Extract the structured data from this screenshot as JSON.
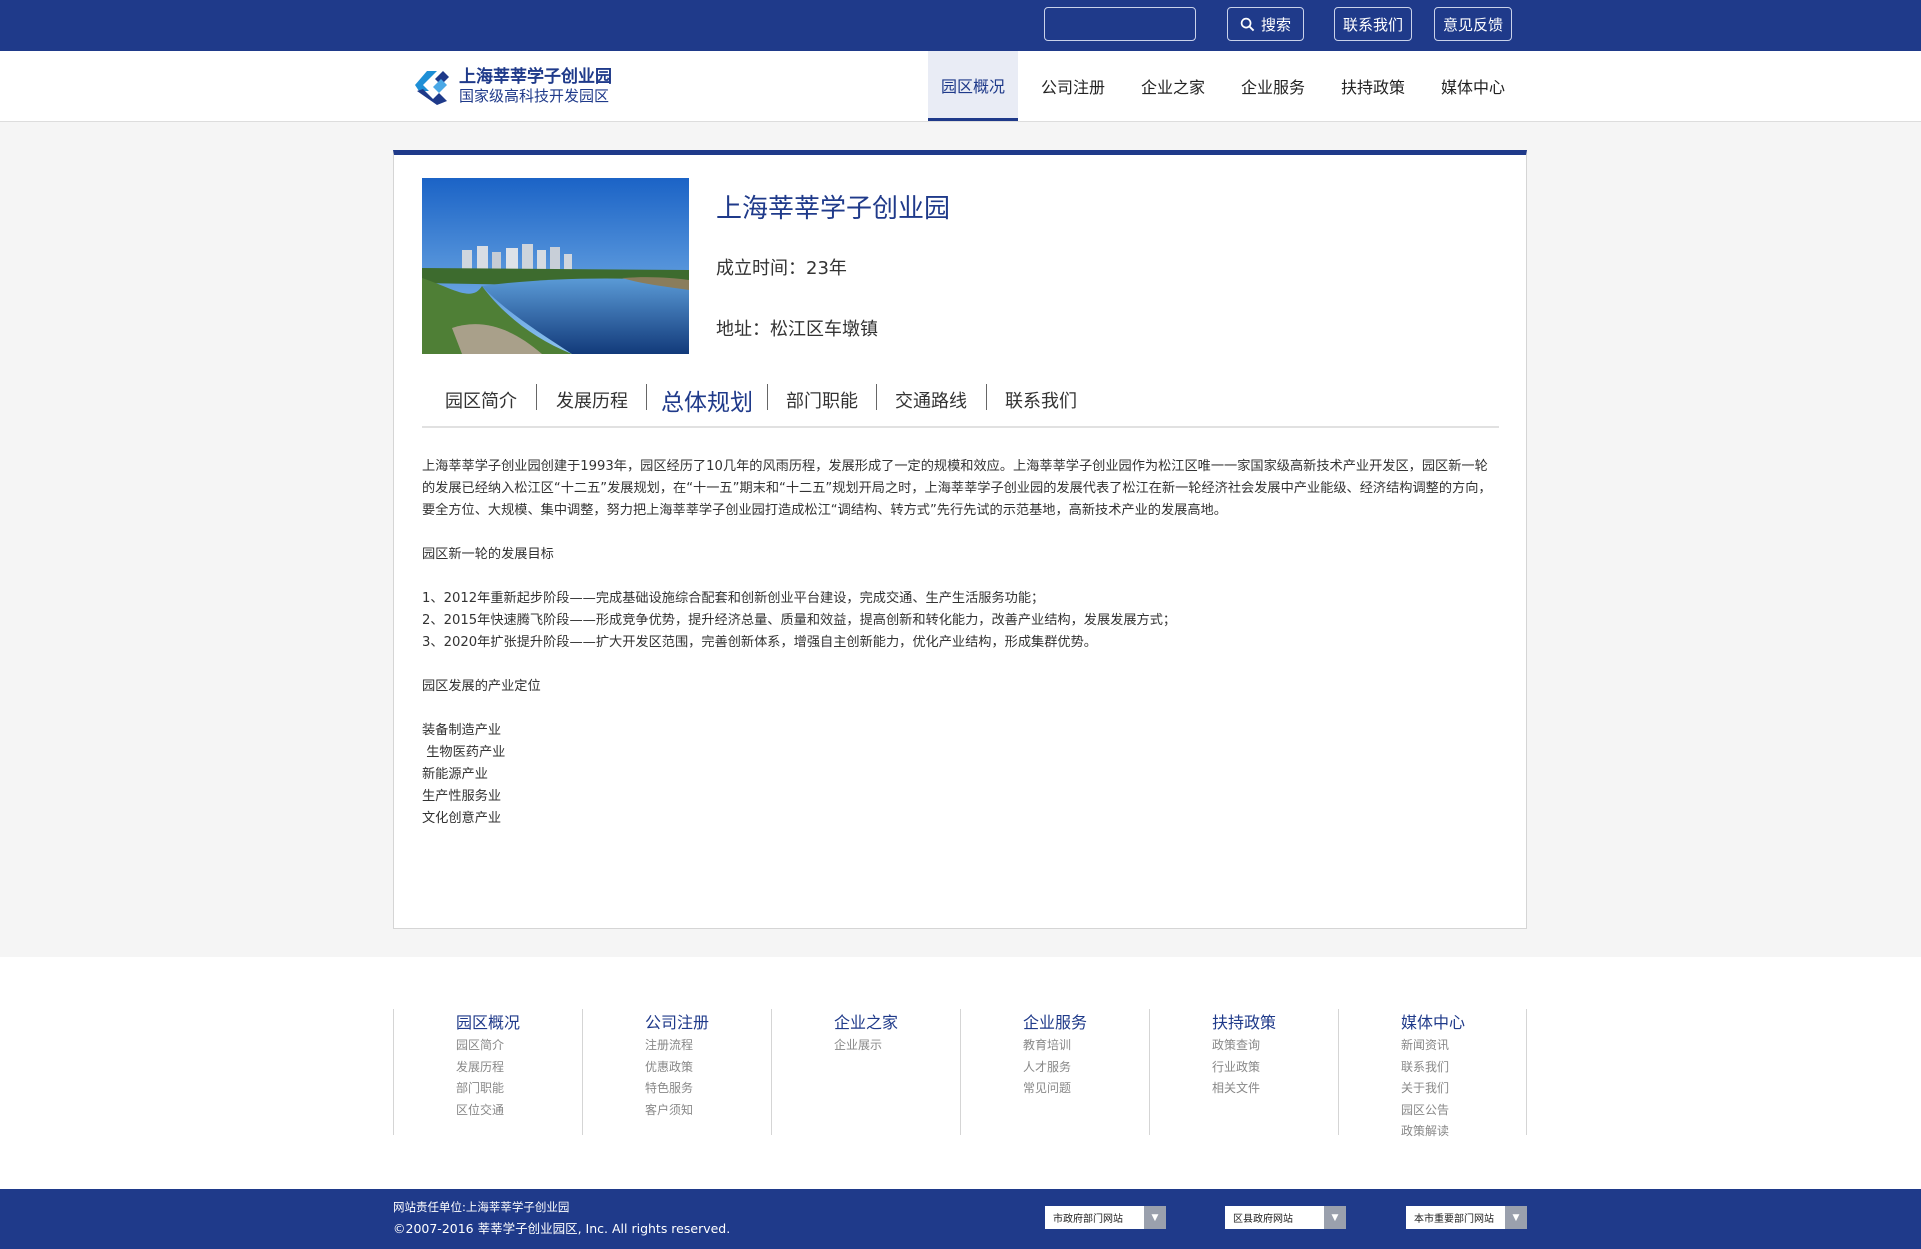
{
  "top_bar": {
    "search_placeholder": "",
    "search_label": "搜索",
    "contact_label": "联系我们",
    "feedback_label": "意见反馈"
  },
  "header": {
    "logo_line1": "上海莘莘学子创业园",
    "logo_line2": "国家级高科技开发园区",
    "nav": [
      {
        "label": "园区概况",
        "active": true
      },
      {
        "label": "公司注册"
      },
      {
        "label": "企业之家"
      },
      {
        "label": "企业服务"
      },
      {
        "label": "扶持政策"
      },
      {
        "label": "媒体中心"
      }
    ]
  },
  "park": {
    "title": "上海莘莘学子创业园",
    "founded": "成立时间：23年",
    "address": "地址：松江区车墩镇"
  },
  "tabs": [
    {
      "label": "园区简介"
    },
    {
      "label": "发展历程"
    },
    {
      "label": "总体规划",
      "active": true
    },
    {
      "label": "部门职能"
    },
    {
      "label": "交通路线"
    },
    {
      "label": "联系我们"
    }
  ],
  "content": {
    "intro": "上海莘莘学子创业园创建于1993年，园区经历了10几年的风雨历程，发展形成了一定的规模和效应。上海莘莘学子创业园作为松江区唯一一家国家级高新技术产业开发区，园区新一轮的发展已经纳入松江区“十二五”发展规划，在“十一五”期末和“十二五”规划开局之时，上海莘莘学子创业园的发展代表了松江在新一轮经济社会发展中产业能级、经济结构调整的方向，要全方位、大规模、集中调整，努力把上海莘莘学子创业园打造成松江“调结构、转方式”先行先试的示范基地，高新技术产业的发展高地。",
    "goals_heading": "园区新一轮的发展目标",
    "goal1": "1、2012年重新起步阶段——完成基础设施综合配套和创新创业平台建设，完成交通、生产生活服务功能；",
    "goal2": "2、2015年快速腾飞阶段——形成竞争优势，提升经济总量、质量和效益，提高创新和转化能力，改善产业结构，发展发展方式；",
    "goal3": "3、2020年扩张提升阶段——扩大开发区范围，完善创新体系，增强自主创新能力，优化产业结构，形成集群优势。",
    "industry_heading": "园区发展的产业定位",
    "industries": [
      "装备制造产业",
      " 生物医药产业",
      "新能源产业",
      "生产性服务业",
      "文化创意产业"
    ]
  },
  "footer": {
    "columns": [
      {
        "title": "园区概况",
        "items": [
          "园区简介",
          "发展历程",
          "部门职能",
          "区位交通"
        ]
      },
      {
        "title": "公司注册",
        "items": [
          "注册流程",
          "优惠政策",
          "特色服务",
          "客户须知"
        ]
      },
      {
        "title": "企业之家",
        "items": [
          "企业展示"
        ]
      },
      {
        "title": "企业服务",
        "items": [
          "教育培训",
          "人才服务",
          "常见问题"
        ]
      },
      {
        "title": "扶持政策",
        "items": [
          "政策查询",
          "行业政策",
          "相关文件"
        ]
      },
      {
        "title": "媒体中心",
        "items": [
          "新闻资讯",
          "联系我们",
          "关于我们",
          "园区公告",
          "政策解读"
        ]
      }
    ],
    "responsible": "网站责任单位:上海莘莘学子创业园",
    "copyright": "©2007-2016 莘莘学子创业园区, Inc. All rights reserved.",
    "selects": [
      "市政府部门网站",
      "区县政府网站",
      "本市重要部门网站"
    ]
  },
  "colors": {
    "brand": "#1f3a8a",
    "page_bg": "#f5f5f5"
  },
  "icons": {
    "search": "search-icon",
    "logo": "logo-mark-icon",
    "dropdown": "dropdown-arrow-icon"
  }
}
